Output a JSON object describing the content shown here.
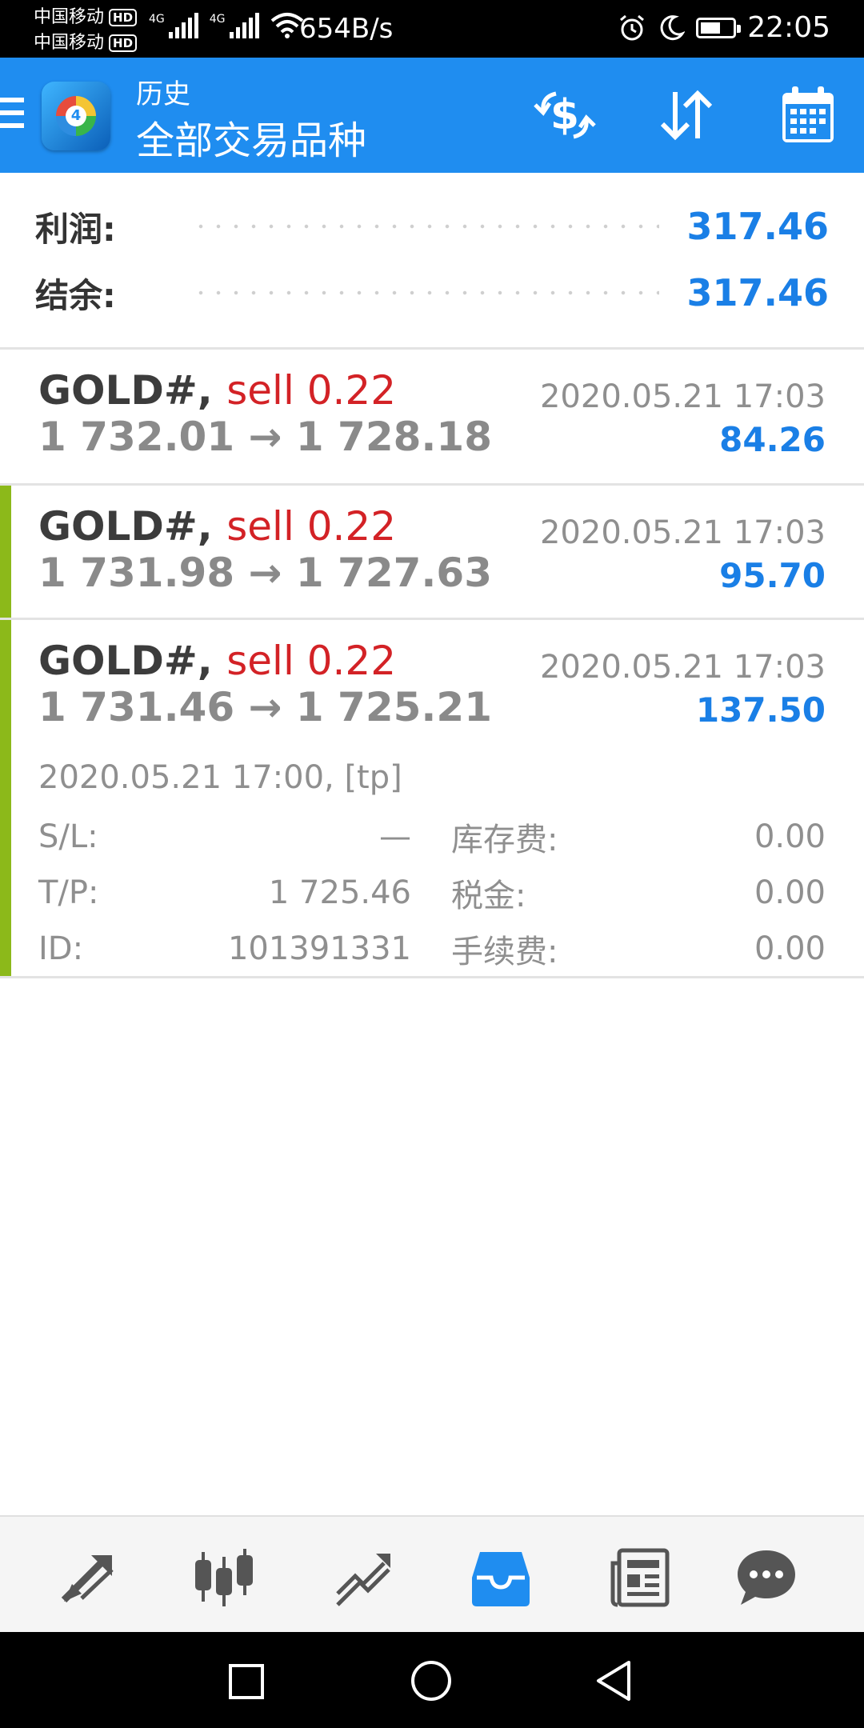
{
  "status_bar": {
    "carrier1": "中国移动",
    "carrier2": "中国移动",
    "hd": "HD",
    "net1": "4G",
    "net2": "4G",
    "speed": "654B/s",
    "time": "22:05"
  },
  "header": {
    "subtitle": "历史",
    "title": "全部交易品种"
  },
  "summary": {
    "profit_label": "利润:",
    "profit_value": "317.46",
    "balance_label": "结余:",
    "balance_value": "317.46"
  },
  "deals": [
    {
      "symbol": "GOLD#,",
      "side": "sell 0.22",
      "prices": "1 732.01 → 1 728.18",
      "time": "2020.05.21 17:03",
      "profit": "84.26"
    },
    {
      "symbol": "GOLD#,",
      "side": "sell 0.22",
      "prices": "1 731.98 → 1 727.63",
      "time": "2020.05.21 17:03",
      "profit": "95.70"
    },
    {
      "symbol": "GOLD#,",
      "side": "sell 0.22",
      "prices": "1 731.46 → 1 725.21",
      "time": "2020.05.21 17:03",
      "profit": "137.50",
      "details": {
        "open": "2020.05.21 17:00, [tp]",
        "sl_label": "S/L:",
        "sl_value": "—",
        "tp_label": "T/P:",
        "tp_value": "1 725.46",
        "id_label": "ID:",
        "id_value": "101391331",
        "swap_label": "库存费:",
        "swap_value": "0.00",
        "tax_label": "税金:",
        "tax_value": "0.00",
        "commission_label": "手续费:",
        "commission_value": "0.00"
      }
    }
  ],
  "bottom_nav": [
    "quotes-icon",
    "chart-icon",
    "trade-icon",
    "history-icon",
    "news-icon",
    "chat-icon"
  ],
  "colors": {
    "appbar": "#1f8df0",
    "profit_blue": "#1a7fe6",
    "sell_red": "#d32226",
    "accent_green": "#8cb91a"
  }
}
